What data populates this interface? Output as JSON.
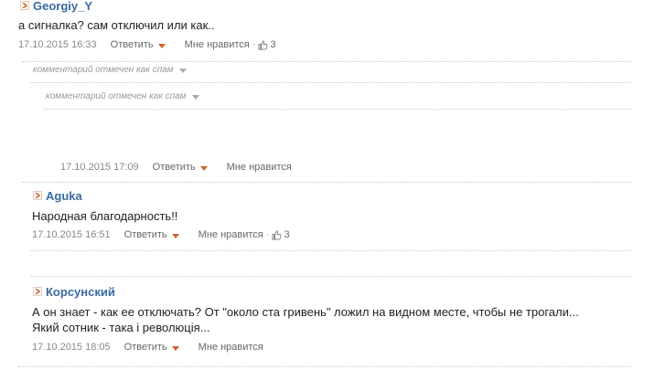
{
  "comments": [
    {
      "author": "Georgiy_Y",
      "text": "а сигналка? сам отключил или как..",
      "date": "17.10.2015 16:33",
      "reply": "Ответить",
      "like": "Мне нравится",
      "like_count": "3"
    },
    {
      "author": "Aguka",
      "text": "Народная благодарность!!",
      "date": "17.10.2015 16:51",
      "reply": "Ответить",
      "like": "Мне нравится",
      "like_count": "3"
    },
    {
      "author": "Корсунский",
      "text_line1": "А он знает - как ее отключать? От \"около ста гривень\" ложил на видном месте, чтобы не трогали...",
      "text_line2": "Який сотник - така і революція...",
      "date": "17.10.2015 18:05",
      "reply": "Ответить",
      "like": "Мне нравится"
    }
  ],
  "spam_notes": [
    "комментарий отмечен как спам",
    "комментарий отмечен как спам"
  ],
  "orphan_meta": {
    "date": "17.10.2015 17:09",
    "reply": "Ответить",
    "like": "Мне нравится"
  },
  "colors": {
    "author": "#3a6aa0",
    "caret": "#d0622a",
    "muted": "#888888"
  }
}
